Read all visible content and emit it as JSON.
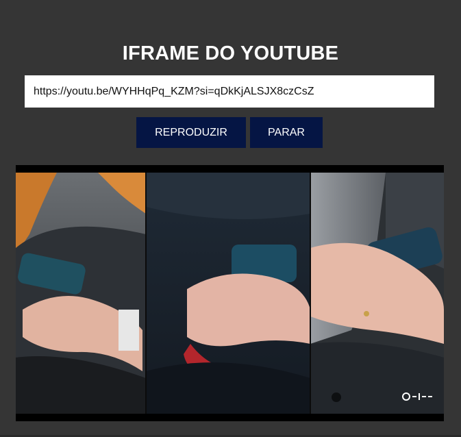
{
  "header": {
    "title": "IFRAME DO YOUTUBE"
  },
  "url_input": {
    "value": "https://youtu.be/WYHHqPq_KZM?si=qDkKjALSJX8czCsZ"
  },
  "controls": {
    "play_label": "REPRODUZIR",
    "stop_label": "PARAR"
  },
  "player": {
    "content": "video-frame",
    "watermark_icon": "channel-logo-icon"
  },
  "colors": {
    "background": "#353535",
    "button": "#051544",
    "button_text": "#ffffff",
    "title_text": "#ffffff"
  }
}
